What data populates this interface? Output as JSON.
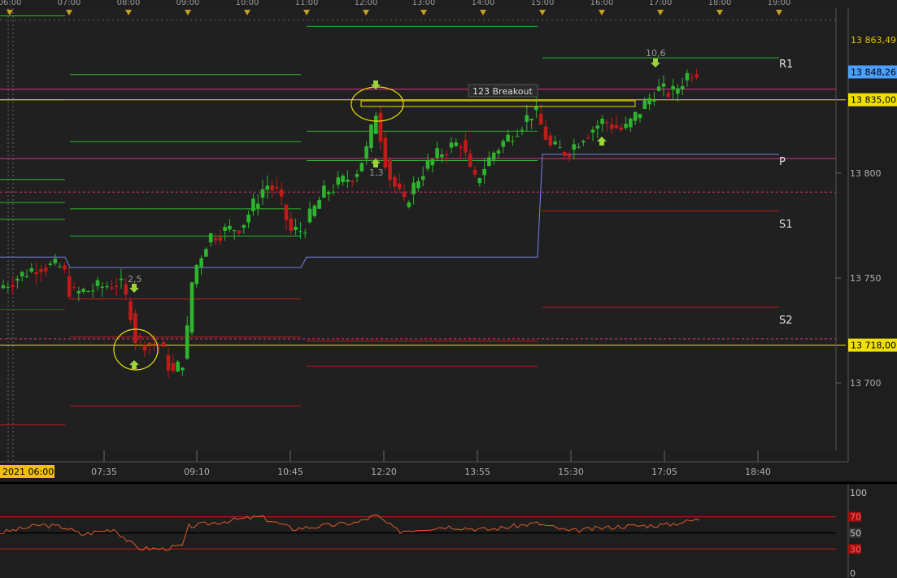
{
  "colors": {
    "background": "#1e1e1e",
    "grid": "#3a3a3a",
    "up": "#2db52d",
    "down": "#c11a1a",
    "pivot_r": "#e0308a",
    "pivot_s": "#c11a1a",
    "pivot_green": "#2db52d",
    "pivot_blue": "#7a80e6",
    "highlight": "#e8e000",
    "price_blue": "#4aa0ff",
    "rsi": "#e05a2a"
  },
  "chart_data": {
    "type": "candlestick",
    "y_axis": {
      "range": [
        13665,
        13880
      ],
      "ticks": [
        13700,
        13750,
        13800
      ],
      "tick_labels": [
        "13 700",
        "13 750",
        "13 800"
      ]
    },
    "price_tags": [
      {
        "label": "13 863,49",
        "value": 13863.49,
        "style": "gray"
      },
      {
        "label": "13 848,26",
        "value": 13848.26,
        "style": "blue"
      },
      {
        "label": "13 835,00",
        "value": 13835.0,
        "style": "yellow"
      },
      {
        "label": "13 718,00",
        "value": 13718.0,
        "style": "yellow"
      }
    ],
    "session_labels": [
      "06:00",
      "07:00",
      "08:00",
      "09:00",
      "10:00",
      "11:00",
      "12:00",
      "13:00",
      "14:00",
      "15:00",
      "16:00",
      "17:00",
      "18:00",
      "19:00"
    ],
    "x_axis_labels": [
      "07:35",
      "09:10",
      "10:45",
      "12:20",
      "13:55",
      "15:30",
      "17:05",
      "18:40"
    ],
    "date_label": "2021 06:00",
    "levels": [
      {
        "label": "R1",
        "value": 13853
      },
      {
        "label": "P",
        "value": 13807
      },
      {
        "label": "S1",
        "value": 13783
      },
      {
        "label": "S2",
        "value": 13737
      }
    ],
    "annotations": [
      {
        "text": "2,5",
        "value": 13750
      },
      {
        "text": "1,3",
        "value": 13804
      },
      {
        "text": "10,6",
        "value": 13860
      },
      {
        "text": "123 Breakout",
        "value": 13843
      }
    ],
    "rsi": {
      "range": [
        0,
        100
      ],
      "tick_labels": [
        "100",
        "70",
        "50",
        "30",
        "0"
      ],
      "ticks": [
        100,
        70,
        50,
        30,
        0
      ]
    }
  }
}
